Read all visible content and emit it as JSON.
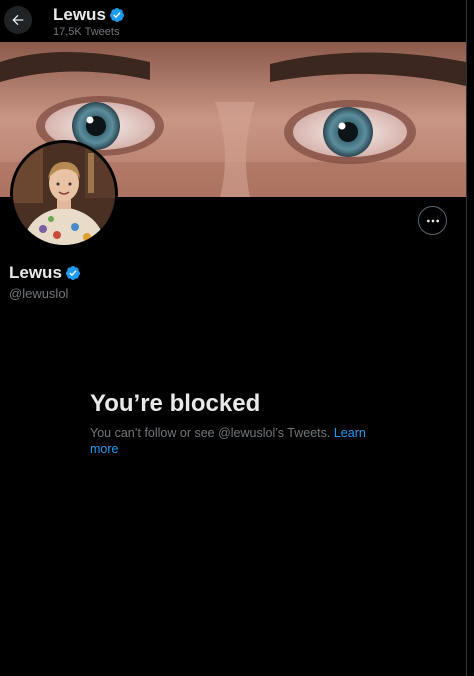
{
  "header": {
    "name": "Lewus",
    "tweet_count": "17,5K Tweets"
  },
  "profile": {
    "name": "Lewus",
    "handle": "@lewuslol"
  },
  "blocked": {
    "title": "You’re blocked",
    "description": "You can’t follow or see @lewuslol’s Tweets. ",
    "learn_more": "Learn more"
  },
  "icons": {
    "back": "arrow-left-icon",
    "verified": "verified-badge-icon",
    "more": "more-dots-icon"
  },
  "colors": {
    "background": "#000000",
    "accent": "#1d9bf0",
    "muted_text": "#71767b"
  }
}
